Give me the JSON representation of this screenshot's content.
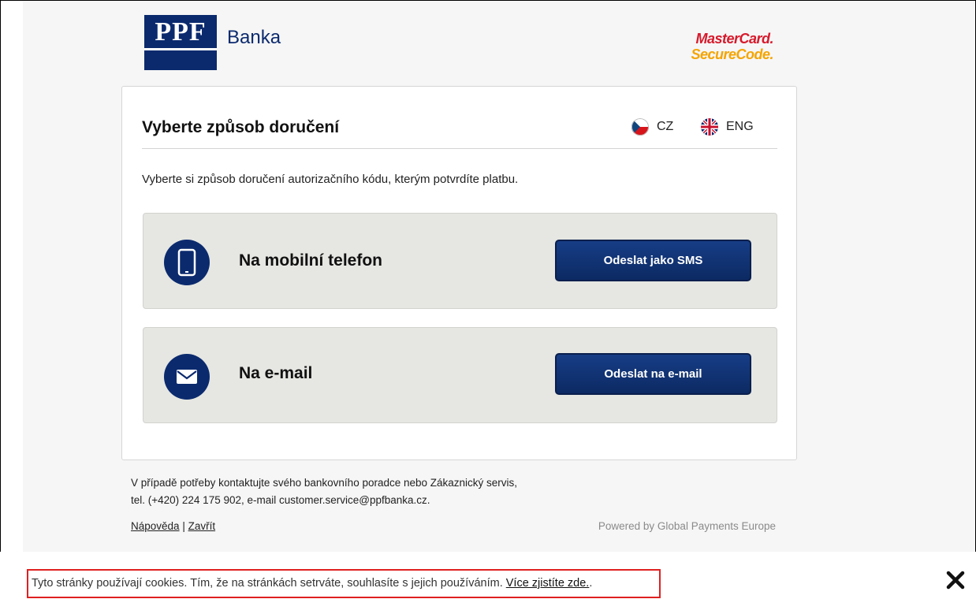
{
  "header": {
    "logo_text": "PPF",
    "brand_name": "Banka",
    "mastercard_line1": "MasterCard.",
    "mastercard_line2": "SecureCode."
  },
  "card": {
    "title": "Vyberte způsob doručení",
    "languages": [
      {
        "code": "CZ",
        "flag": "czech-flag-icon"
      },
      {
        "code": "ENG",
        "flag": "uk-flag-icon"
      }
    ],
    "intro": "Vyberte si způsob doručení autorizačního kódu, kterým potvrdíte platbu.",
    "options": [
      {
        "icon": "mobile-phone-icon",
        "label": "Na mobilní telefon",
        "button": "Odeslat jako SMS"
      },
      {
        "icon": "envelope-icon",
        "label": "Na e-mail",
        "button": "Odeslat na e-mail"
      }
    ]
  },
  "footer": {
    "contact_line1": "V případě potřeby kontaktujte svého bankovního poradce nebo Zákaznický servis,",
    "contact_line2": "tel. (+420) 224 175 902, e-mail customer.service@ppfbanka.cz.",
    "help_link": "Nápověda",
    "separator": " | ",
    "close_link": "Zavřít",
    "powered_by": "Powered by Global Payments Europe"
  },
  "cookie_bar": {
    "text": "Tyto stránky používají cookies. Tím, že na stránkách setrváte, souhlasíte s jejich používáním. ",
    "more_link": "Více zjistíte zde.",
    "trailing": ".",
    "close_icon": "close-icon"
  },
  "colors": {
    "brand_navy": "#0b2a6e",
    "option_bg": "#e6e7e2",
    "cookie_border": "#e02020",
    "mastercard_red": "#d7192b",
    "mastercard_orange": "#f5a400"
  }
}
